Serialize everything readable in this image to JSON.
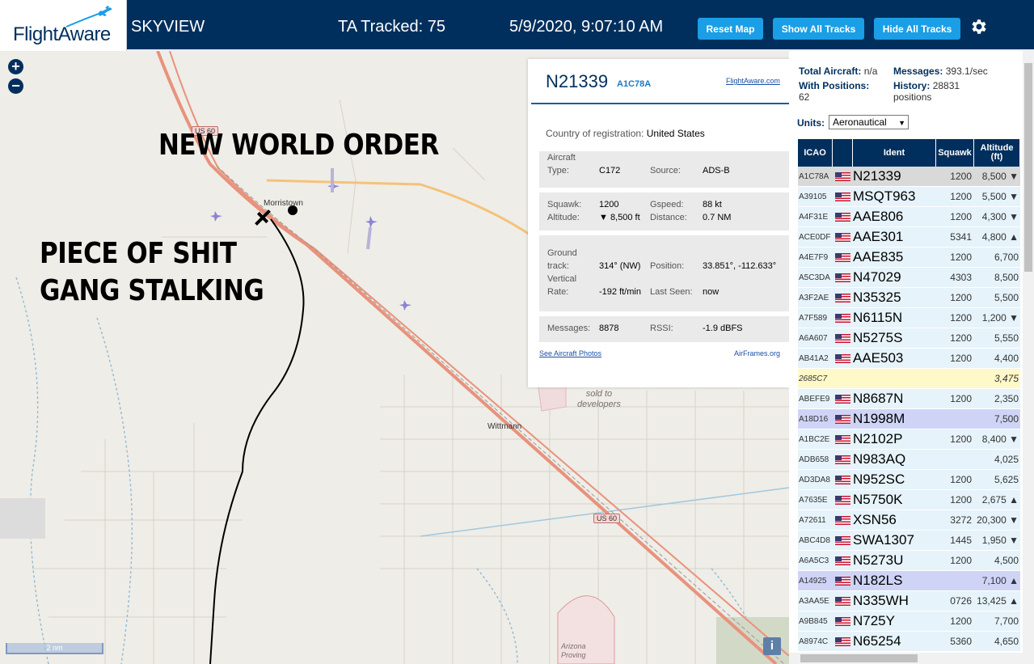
{
  "header": {
    "logo_text": "FlightAware",
    "app_title": "SKYVIEW",
    "tracked": "TA Tracked: 75",
    "clock": "5/9/2020, 9:07:10 AM",
    "reset_label": "Reset Map",
    "show_label": "Show All Tracks",
    "hide_label": "Hide All Tracks",
    "settings_icon": "gear-icon"
  },
  "map": {
    "zoom_in": "+",
    "zoom_out": "−",
    "annotation_top": "NEW WORLD ORDER",
    "annotation_left_1": "PIECE OF SHIT",
    "annotation_left_2": "GANG STALKING",
    "place_morristown": "Morristown",
    "place_wittmann": "Wittmann",
    "place_sold_1": "sold to",
    "place_sold_2": "developers",
    "place_arizona_1": "Arizona",
    "place_arizona_2": "Proving",
    "shield_1": "US 60",
    "shield_2": "US 60",
    "scale": "2 nm",
    "info": "i"
  },
  "popup": {
    "reg": "N21339",
    "icao": "A1C78A",
    "fa_link": "FlightAware.com",
    "country_label": "Country of registration:",
    "country": "United States",
    "aircraft_type_label_1": "Aircraft",
    "aircraft_type_label_2": "Type:",
    "aircraft_type": "C172",
    "source_label": "Source:",
    "source": "ADS-B",
    "squawk_label": "Squawk:",
    "squawk": "1200",
    "gspeed_label": "Gspeed:",
    "gspeed": "88 kt",
    "altitude_label": "Altitude:",
    "altitude": "▼ 8,500 ft",
    "distance_label": "Distance:",
    "distance": "0.7 NM",
    "track_label_1": "Ground",
    "track_label_2": "track:",
    "track": "314° (NW)",
    "position_label": "Position:",
    "position": "33.851°, -112.633°",
    "vrate_label_1": "Vertical",
    "vrate_label_2": "Rate:",
    "vrate": "-192 ft/min",
    "lastseen_label": "Last Seen:",
    "lastseen": "now",
    "messages_label": "Messages:",
    "messages": "8878",
    "rssi_label": "RSSI:",
    "rssi": "-1.9 dBFS",
    "photos_link": "See Aircraft Photos",
    "airframes_link": "AirFrames.org"
  },
  "panel": {
    "total_label": "Total Aircraft:",
    "total": "n/a",
    "messages_label": "Messages:",
    "messages": "393.1/sec",
    "withpos_label": "With Positions:",
    "withpos": "62",
    "history_label": "History:",
    "history": "28831",
    "history_unit": "positions",
    "units_label": "Units:",
    "units_value": "Aeronautical",
    "columns": [
      "ICAO",
      "",
      "Ident",
      "Squawk",
      "Altitude (ft)"
    ],
    "rows": [
      {
        "icao": "A1C78A",
        "flag": true,
        "ident": "N21339",
        "squawk": "1200",
        "alt": "8,500 ▼",
        "style": "sel"
      },
      {
        "icao": "A39105",
        "flag": true,
        "ident": "MSQT963",
        "squawk": "1200",
        "alt": "5,500 ▼",
        "style": ""
      },
      {
        "icao": "A4F31E",
        "flag": true,
        "ident": "AAE806",
        "squawk": "1200",
        "alt": "4,300 ▼",
        "style": ""
      },
      {
        "icao": "ACE0DF",
        "flag": true,
        "ident": "AAE301",
        "squawk": "5341",
        "alt": "4,800 ▲",
        "style": ""
      },
      {
        "icao": "A4E7F9",
        "flag": true,
        "ident": "AAE835",
        "squawk": "1200",
        "alt": "6,700",
        "style": ""
      },
      {
        "icao": "A5C3DA",
        "flag": true,
        "ident": "N47029",
        "squawk": "4303",
        "alt": "8,500",
        "style": ""
      },
      {
        "icao": "A3F2AE",
        "flag": true,
        "ident": "N35325",
        "squawk": "1200",
        "alt": "5,500",
        "style": ""
      },
      {
        "icao": "A7F589",
        "flag": true,
        "ident": "N6115N",
        "squawk": "1200",
        "alt": "1,200 ▼",
        "style": ""
      },
      {
        "icao": "A6A607",
        "flag": true,
        "ident": "N5275S",
        "squawk": "1200",
        "alt": "5,550",
        "style": ""
      },
      {
        "icao": "AB41A2",
        "flag": true,
        "ident": "AAE503",
        "squawk": "1200",
        "alt": "4,400",
        "style": ""
      },
      {
        "icao": "2685C7",
        "flag": false,
        "ident": "",
        "squawk": "",
        "alt": "3,475",
        "style": "noflag"
      },
      {
        "icao": "ABEFE9",
        "flag": true,
        "ident": "N8687N",
        "squawk": "1200",
        "alt": "2,350",
        "style": ""
      },
      {
        "icao": "A18D16",
        "flag": true,
        "ident": "N1998M",
        "squawk": "",
        "alt": "7,500",
        "style": "ghost"
      },
      {
        "icao": "A1BC2E",
        "flag": true,
        "ident": "N2102P",
        "squawk": "1200",
        "alt": "8,400 ▼",
        "style": ""
      },
      {
        "icao": "ADB658",
        "flag": true,
        "ident": "N983AQ",
        "squawk": "",
        "alt": "4,025",
        "style": ""
      },
      {
        "icao": "AD3DA8",
        "flag": true,
        "ident": "N952SC",
        "squawk": "1200",
        "alt": "5,625",
        "style": ""
      },
      {
        "icao": "A7635E",
        "flag": true,
        "ident": "N5750K",
        "squawk": "1200",
        "alt": "2,675 ▲",
        "style": ""
      },
      {
        "icao": "A72611",
        "flag": true,
        "ident": "XSN56",
        "squawk": "3272",
        "alt": "20,300 ▼",
        "style": ""
      },
      {
        "icao": "ABC4D8",
        "flag": true,
        "ident": "SWA1307",
        "squawk": "1445",
        "alt": "1,950 ▼",
        "style": ""
      },
      {
        "icao": "A6A5C3",
        "flag": true,
        "ident": "N5273U",
        "squawk": "1200",
        "alt": "4,500",
        "style": ""
      },
      {
        "icao": "A14925",
        "flag": true,
        "ident": "N182LS",
        "squawk": "",
        "alt": "7,100 ▲",
        "style": "ghost"
      },
      {
        "icao": "A3AA5E",
        "flag": true,
        "ident": "N335WH",
        "squawk": "0726",
        "alt": "13,425 ▲",
        "style": ""
      },
      {
        "icao": "A9B845",
        "flag": true,
        "ident": "N725Y",
        "squawk": "1200",
        "alt": "7,700",
        "style": ""
      },
      {
        "icao": "A8974C",
        "flag": true,
        "ident": "N65254",
        "squawk": "5360",
        "alt": "4,650",
        "style": ""
      }
    ]
  },
  "colors": {
    "header_bg": "#002f5d",
    "button": "#1a9ee6",
    "highway": "#e8927c",
    "road_orange": "#f5c27a",
    "track_line": "#000000",
    "plane_icon": "#8a83d8"
  }
}
